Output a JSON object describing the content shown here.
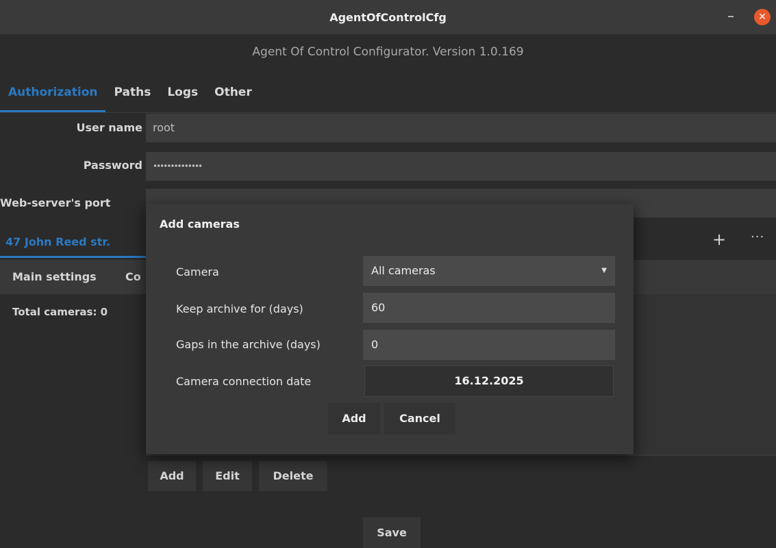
{
  "window": {
    "title": "AgentOfControlCfg",
    "minimize_glyph": "–",
    "close_glyph": "✕"
  },
  "header": {
    "version_text": "Agent Of Control Configurator. Version 1.0.169"
  },
  "tabs": [
    {
      "label": "Authorization",
      "active": true
    },
    {
      "label": "Paths",
      "active": false
    },
    {
      "label": "Logs",
      "active": false
    },
    {
      "label": "Other",
      "active": false
    }
  ],
  "auth": {
    "username_label": "User name",
    "username_value": "root",
    "password_label": "Password",
    "password_value": "••••••••••••••",
    "port_label": "Web-server's port"
  },
  "objects": {
    "active_tab": "47 John Reed str.",
    "add_icon": "+",
    "more_icon": "···"
  },
  "sub_tabs": {
    "main": "Main settings",
    "second_partial": "Co"
  },
  "cameras_summary": "Total cameras: 0",
  "list_buttons": {
    "add": "Add",
    "edit": "Edit",
    "delete": "Delete"
  },
  "dialog": {
    "title": "Add cameras",
    "camera_label": "Camera",
    "camera_value": "All cameras",
    "keep_label": "Keep archive for (days)",
    "keep_value": "60",
    "gaps_label": "Gaps in the archive (days)",
    "gaps_value": "0",
    "date_label": "Camera connection date",
    "date_value": "16.12.2025",
    "add_button": "Add",
    "cancel_button": "Cancel"
  },
  "save_button": "Save",
  "colors": {
    "accent": "#2b79c2",
    "close_button": "#e9592b"
  }
}
